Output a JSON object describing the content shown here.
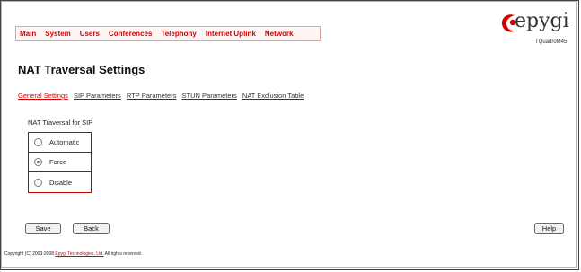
{
  "menu": {
    "items": [
      "Main",
      "System",
      "Users",
      "Conferences",
      "Telephony",
      "Internet Uplink",
      "Network"
    ]
  },
  "logo": {
    "word": "epygi",
    "model": "TQuadroM45"
  },
  "page_title": "NAT Traversal Settings",
  "tabs": [
    {
      "label": "General Settings",
      "active": true
    },
    {
      "label": "SIP Parameters",
      "active": false
    },
    {
      "label": "RTP Parameters",
      "active": false
    },
    {
      "label": "STUN Parameters",
      "active": false
    },
    {
      "label": "NAT Exclusion Table",
      "active": false
    }
  ],
  "nat_sip": {
    "label": "NAT Traversal for SIP",
    "options": [
      {
        "label": "Automatic",
        "checked": false
      },
      {
        "label": "Force",
        "checked": true
      },
      {
        "label": "Disable",
        "checked": false
      }
    ]
  },
  "buttons": {
    "save": "Save",
    "back": "Back",
    "help": "Help"
  },
  "footer": {
    "prefix": "Copyright (C) 2003-2008 ",
    "link": "Epygi Technologies, Ltd.",
    "suffix": " All rights reserved."
  },
  "colors": {
    "accent": "#d40000",
    "border_accent": "#c00000",
    "radio_selected": "#2a8a2a"
  }
}
